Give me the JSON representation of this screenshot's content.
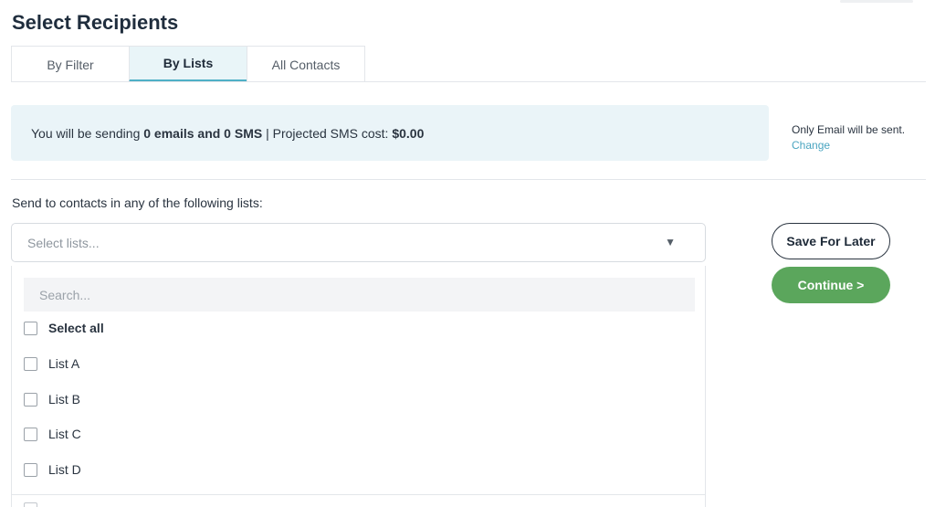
{
  "page": {
    "title": "Select Recipients"
  },
  "tabs": [
    {
      "label": "By Filter",
      "active": false
    },
    {
      "label": "By Lists",
      "active": true
    },
    {
      "label": "All Contacts",
      "active": false
    }
  ],
  "banner": {
    "prefix": "You will be sending ",
    "counts": "0 emails and 0 SMS",
    "middle": " | Projected SMS cost: ",
    "cost": "$0.00"
  },
  "mode_note": {
    "text": "Only Email will be sent.",
    "link": "Change"
  },
  "lists_section": {
    "label": "Send to contacts in any of the following lists:",
    "select_placeholder": "Select lists...",
    "search_placeholder": "Search...",
    "select_all_label": "Select all",
    "options": [
      "List A",
      "List B",
      "List C",
      "List D"
    ]
  },
  "actions": {
    "save_label": "Save For Later",
    "continue_label": "Continue >"
  },
  "colors": {
    "accent": "#4fb0c6",
    "continue": "#5ba65c",
    "banner_bg": "#eaf4f8"
  }
}
